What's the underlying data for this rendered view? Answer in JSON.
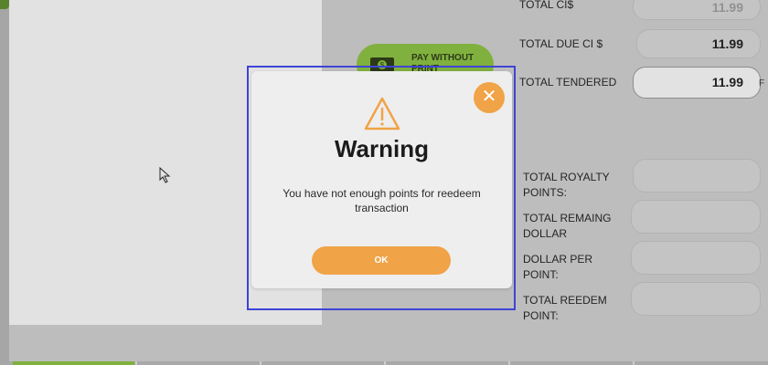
{
  "app": {
    "pay_button_label": "PAY WITHOUT PRINT",
    "fields": [
      {
        "label": "TOTAL CI$",
        "value": "11.99"
      },
      {
        "label": "TOTAL DUE CI $",
        "value": "11.99"
      },
      {
        "label": "TOTAL TENDERED",
        "value": "11.99"
      },
      {
        "label": "TOTAL ROYALTY POINTS:",
        "value": ""
      },
      {
        "label": "TOTAL REMAING DOLLAR",
        "value": ""
      },
      {
        "label": "DOLLAR PER POINT:",
        "value": ""
      },
      {
        "label": "TOTAL REEDEM POINT:",
        "value": ""
      }
    ],
    "side_cut_text": "F"
  },
  "dialog": {
    "title": "Warning",
    "message": "You have not enough points for reedeem transaction",
    "ok_label": "OK",
    "close_symbol": "✕",
    "icons": {
      "warning": "warning-triangle-icon",
      "close": "close-icon",
      "cash": "cash-icon",
      "cursor": "mouse-cursor-icon"
    }
  },
  "colors": {
    "accent_orange": "#f0a347",
    "pay_green": "#8cc63f",
    "selection_outline": "#3d44d6"
  }
}
